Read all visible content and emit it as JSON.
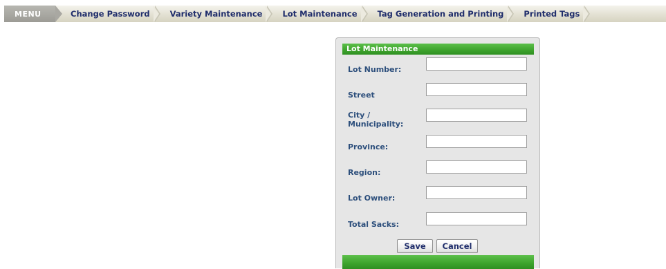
{
  "menu": {
    "head_label": "MENU",
    "items": [
      {
        "label": "Change Password"
      },
      {
        "label": "Variety Maintenance"
      },
      {
        "label": "Lot Maintenance"
      },
      {
        "label": "Tag Generation and Printing"
      },
      {
        "label": "Printed Tags"
      }
    ]
  },
  "form": {
    "title": "Lot Maintenance",
    "fields": [
      {
        "label": "Lot Number:",
        "value": ""
      },
      {
        "label": "Street",
        "value": ""
      },
      {
        "label": "City / Municipality:",
        "value": ""
      },
      {
        "label": "Province:",
        "value": ""
      },
      {
        "label": "Region:",
        "value": ""
      },
      {
        "label": "Lot Owner:",
        "value": ""
      },
      {
        "label": "Total Sacks:",
        "value": ""
      }
    ],
    "save_label": "Save",
    "cancel_label": "Cancel"
  },
  "colors": {
    "header_green": "#3da32c",
    "label_blue": "#2d4f7c",
    "menu_text": "#1f2d6b",
    "menu_head_gray": "#a9a8a2"
  }
}
